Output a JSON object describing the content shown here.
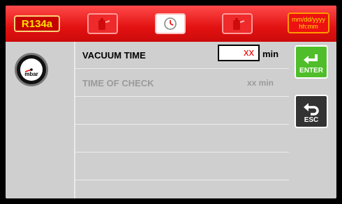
{
  "header": {
    "refrigerant": "R134a",
    "tabs": [
      {
        "icon": "cylinder-icon",
        "active": false
      },
      {
        "icon": "clock-icon",
        "active": true
      },
      {
        "icon": "cylinder-icon",
        "active": false
      }
    ],
    "date": "mm/dd/yyyy",
    "time": "hh:mm"
  },
  "left": {
    "gauge_unit": "mbar",
    "gauge_icon": "vacuum-gauge-icon"
  },
  "rows": [
    {
      "label": "VACUUM TIME",
      "value": "xx",
      "unit": "min"
    },
    {
      "label": "TIME OF CHECK",
      "value": "xx min"
    }
  ],
  "buttons": {
    "enter_label": "ENTER",
    "esc_label": "ESC"
  },
  "colors": {
    "header_red": "#e31212",
    "accent_yellow": "#ffe000",
    "enter_green": "#4fbe2a",
    "esc_dark": "#333333",
    "value_red": "#e00000"
  }
}
